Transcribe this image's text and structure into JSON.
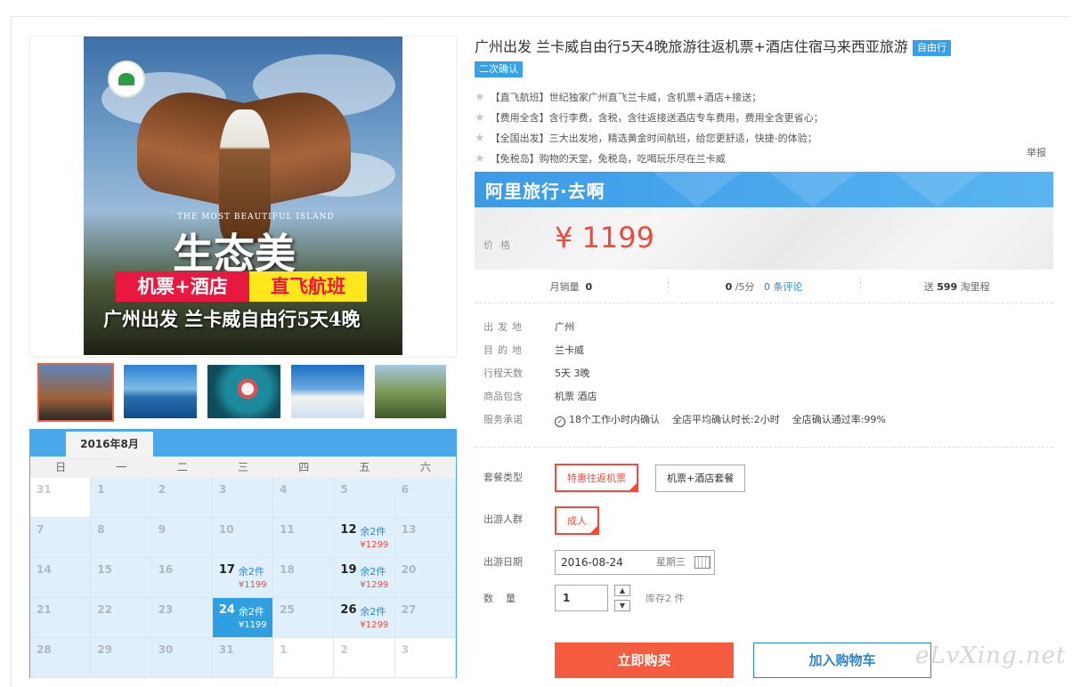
{
  "poster": {
    "tagline": "THE MOST BEAUTIFUL ISLAND",
    "headline": "生态美",
    "tag_red": "机票+酒店",
    "tag_yellow": "直飞航班",
    "route": "广州出发 兰卡威自由行5天4晚"
  },
  "calendar": {
    "month": "2016年8月",
    "weekdays": [
      "日",
      "一",
      "二",
      "三",
      "四",
      "五",
      "六"
    ],
    "rows": [
      [
        {
          "d": "31",
          "s": "white"
        },
        {
          "d": "1"
        },
        {
          "d": "2"
        },
        {
          "d": "3"
        },
        {
          "d": "4"
        },
        {
          "d": "5"
        },
        {
          "d": "6"
        }
      ],
      [
        {
          "d": "7"
        },
        {
          "d": "8"
        },
        {
          "d": "9"
        },
        {
          "d": "10"
        },
        {
          "d": "11"
        },
        {
          "d": "12",
          "left": "余2件",
          "price": "¥1299",
          "s": "avail"
        },
        {
          "d": "13"
        }
      ],
      [
        {
          "d": "14"
        },
        {
          "d": "15"
        },
        {
          "d": "16"
        },
        {
          "d": "17",
          "left": "余2件",
          "price": "¥1199",
          "s": "avail"
        },
        {
          "d": "18"
        },
        {
          "d": "19",
          "left": "余2件",
          "price": "¥1299",
          "s": "avail"
        },
        {
          "d": "20"
        }
      ],
      [
        {
          "d": "21"
        },
        {
          "d": "22"
        },
        {
          "d": "23"
        },
        {
          "d": "24",
          "left": "余2件",
          "price": "¥1199",
          "s": "sel"
        },
        {
          "d": "25"
        },
        {
          "d": "26",
          "left": "余2件",
          "price": "¥1299",
          "s": "avail"
        },
        {
          "d": "27"
        }
      ],
      [
        {
          "d": "28"
        },
        {
          "d": "29"
        },
        {
          "d": "30"
        },
        {
          "d": "31"
        },
        {
          "d": "1",
          "s": "white"
        },
        {
          "d": "2",
          "s": "white"
        },
        {
          "d": "3",
          "s": "white"
        }
      ]
    ]
  },
  "product": {
    "title": "广州出发 兰卡威自由行5天4晚旅游往返机票+酒店住宿马来西亚旅游",
    "badge": "自由行",
    "badge2": "二次确认",
    "features": [
      "【直飞航班】世纪独家广州直飞兰卡威，含机票+酒店+接送；",
      "【费用全含】含行李费，含税，含往返接送酒店专车费用，费用全含更省心；",
      "【全国出发】三大出发地，精选黄金时间航班，给您更舒适，快捷-的体验；",
      "【免税岛】购物的天堂，免税岛，吃喝玩乐尽在兰卡威"
    ],
    "report": "举报"
  },
  "price": {
    "brand": "阿里旅行·去啊",
    "label": "价格",
    "value": "¥ 1199"
  },
  "stats": {
    "sales_label": "月销量",
    "sales": "0",
    "rating": "0",
    "rating_unit": "/5分",
    "reviews": "0 条评论",
    "miles_prefix": "送",
    "miles": "599",
    "miles_suffix": "淘里程"
  },
  "info": {
    "depart_k": "出发地",
    "depart_v": "广州",
    "dest_k": "目的地",
    "dest_v": "兰卡威",
    "days_k": "行程天数",
    "days_v": "5天 3晚",
    "incl_k": "商品包含",
    "incl_v": "机票  酒店",
    "promise_k": "服务承诺",
    "promise_v": "18个工作小时内确认",
    "promise_avg": "全店平均确认时长:2小时",
    "promise_rate": "全店确认通过率:99%"
  },
  "options": {
    "pkg_label": "套餐类型",
    "pkg_1": "特惠往返机票",
    "pkg_2": "机票+酒店套餐",
    "crowd_label": "出游人群",
    "crowd_1": "成人",
    "date_label": "出游日期",
    "date_value": "2016-08-24",
    "date_weekday": "星期三",
    "qty_label": "数量",
    "qty_value": "1",
    "stock": "库存2 件"
  },
  "actions": {
    "buy": "立即购买",
    "cart": "加入购物车"
  },
  "watermark": "eLvXing.net"
}
